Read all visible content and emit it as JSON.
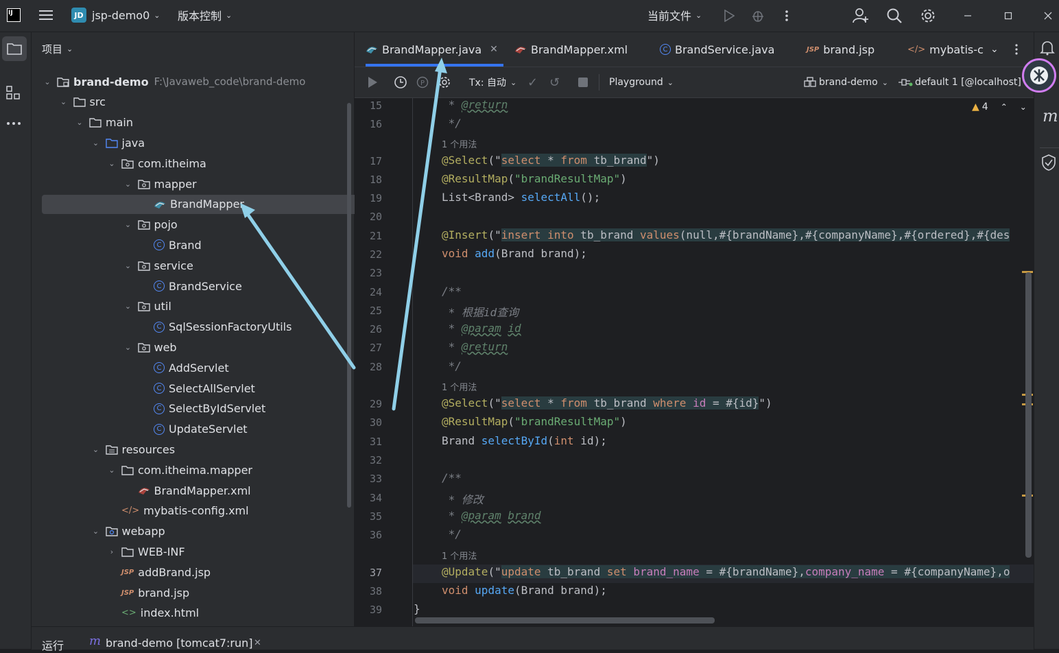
{
  "titlebar": {
    "project_badge": "JD",
    "project_name": "jsp-demo0",
    "vcs_label": "版本控制",
    "run_config": "当前文件"
  },
  "project_panel": {
    "title": "项目",
    "tree": [
      {
        "label": "brand-demo",
        "path": "F:\\Javaweb_code\\brand-demo",
        "icon": "module-folder-icon",
        "depth": 0,
        "expanded": true
      },
      {
        "label": "src",
        "icon": "folder-icon",
        "depth": 1,
        "expanded": true
      },
      {
        "label": "main",
        "icon": "folder-icon",
        "depth": 2,
        "expanded": true
      },
      {
        "label": "java",
        "icon": "source-folder-icon",
        "depth": 3,
        "expanded": true
      },
      {
        "label": "com.itheima",
        "icon": "package-icon",
        "depth": 4,
        "expanded": true
      },
      {
        "label": "mapper",
        "icon": "package-icon",
        "depth": 5,
        "expanded": true
      },
      {
        "label": "BrandMapper",
        "icon": "mybatis-icon",
        "depth": 6,
        "selected": true
      },
      {
        "label": "pojo",
        "icon": "package-icon",
        "depth": 5,
        "expanded": true
      },
      {
        "label": "Brand",
        "icon": "class-icon",
        "depth": 6
      },
      {
        "label": "service",
        "icon": "package-icon",
        "depth": 5,
        "expanded": true
      },
      {
        "label": "BrandService",
        "icon": "class-icon",
        "depth": 6
      },
      {
        "label": "util",
        "icon": "package-icon",
        "depth": 5,
        "expanded": true
      },
      {
        "label": "SqlSessionFactoryUtils",
        "icon": "class-icon",
        "depth": 6
      },
      {
        "label": "web",
        "icon": "package-icon",
        "depth": 5,
        "expanded": true
      },
      {
        "label": "AddServlet",
        "icon": "class-icon",
        "depth": 6
      },
      {
        "label": "SelectAllServlet",
        "icon": "class-icon",
        "depth": 6
      },
      {
        "label": "SelectByIdServlet",
        "icon": "class-icon",
        "depth": 6
      },
      {
        "label": "UpdateServlet",
        "icon": "class-icon",
        "depth": 6
      },
      {
        "label": "resources",
        "icon": "resources-folder-icon",
        "depth": 3,
        "expanded": true
      },
      {
        "label": "com.itheima.mapper",
        "icon": "folder-icon",
        "depth": 4,
        "expanded": true
      },
      {
        "label": "BrandMapper.xml",
        "icon": "mybatis-xml-icon",
        "depth": 5
      },
      {
        "label": "mybatis-config.xml",
        "icon": "xml-icon",
        "depth": 4
      },
      {
        "label": "webapp",
        "icon": "web-folder-icon",
        "depth": 3,
        "expanded": true
      },
      {
        "label": "WEB-INF",
        "icon": "folder-icon",
        "depth": 4,
        "expanded": false
      },
      {
        "label": "addBrand.jsp",
        "icon": "jsp-icon",
        "depth": 4
      },
      {
        "label": "brand.jsp",
        "icon": "jsp-icon",
        "depth": 4
      },
      {
        "label": "index.html",
        "icon": "html-icon",
        "depth": 4
      }
    ]
  },
  "editor": {
    "tabs": [
      {
        "label": "BrandMapper.java",
        "active": true,
        "closable": true
      },
      {
        "label": "BrandMapper.xml"
      },
      {
        "label": "BrandService.java"
      },
      {
        "label": "brand.jsp"
      },
      {
        "label": "mybatis-c"
      }
    ],
    "db_toolbar": {
      "tx_label": "Tx: 自动",
      "playground_label": "Playground",
      "datasource": "brand-demo",
      "session": "default 1 [@localhost]"
    },
    "inspection_count": "4",
    "usage_hint": "1 个用法",
    "line_numbers": [
      "15",
      "16",
      "17",
      "18",
      "19",
      "20",
      "21",
      "22",
      "23",
      "24",
      "25",
      "26",
      "27",
      "28",
      "29",
      "30",
      "31",
      "32",
      "33",
      "34",
      "35",
      "36",
      "37",
      "38",
      "39"
    ],
    "code": {
      "l15_star": " * ",
      "l15_tag": "@return",
      "l16": " */",
      "l17_ann": "@Select",
      "l17_open": "(\"",
      "l17_kw1": "select",
      "l17_mid": " * ",
      "l17_kw2": "from",
      "l17_rest": " tb_brand",
      "l17_close": "\")",
      "l18_ann": "@ResultMap",
      "l18_rest": "(",
      "l18_str": "\"brandResultMap\"",
      "l18_close": ")",
      "l19_a": "List<Brand> ",
      "l19_fn": "selectAll",
      "l19_b": "();",
      "l21_ann": "@Insert",
      "l21_open": "(\"",
      "l21_kw1": "insert into",
      "l21_t": " tb_brand ",
      "l21_kw2": "values",
      "l21_rest": "(null,#{brandName},#{companyName},#{ordered},#{des",
      "l22_kw": "void ",
      "l22_fn": "add",
      "l22_rest": "(Brand brand);",
      "l24": "/**",
      "l25": " * 根据id查询",
      "l26_star": " * ",
      "l26_tag": "@param",
      "l26_sp": " ",
      "l26_id": "id",
      "l27_star": " * ",
      "l27_tag": "@return",
      "l28": " */",
      "l29_ann": "@Select",
      "l29_open": "(\"",
      "l29_kw1": "select",
      "l29_mid": " * ",
      "l29_kw2": "from",
      "l29_t": " tb_brand ",
      "l29_kw3": "where",
      "l29_id": " id",
      "l29_rest": " = #{id}",
      "l29_close": "\")",
      "l30_ann": "@ResultMap",
      "l30_rest": "(",
      "l30_str": "\"brandResultMap\"",
      "l30_close": ")",
      "l31_a": "Brand ",
      "l31_fn": "selectById",
      "l31_b": "(",
      "l31_kw": "int",
      "l31_c": " id);",
      "l33": "/**",
      "l34": " * 修改",
      "l35_star": " * ",
      "l35_tag": "@param",
      "l35_sp": " ",
      "l35_id": "brand",
      "l36": " */",
      "l37_ann": "@Update",
      "l37_open": "(\"",
      "l37_kw1": "update",
      "l37_t": " tb_brand ",
      "l37_kw2": "set",
      "l37_c1": " brand_name",
      "l37_m1": " = #{brandName},",
      "l37_c2": "company_name",
      "l37_m2": " = #{companyName},o",
      "l38_kw": "void ",
      "l38_fn": "update",
      "l38_rest": "(Brand brand);",
      "l39": "}"
    }
  },
  "bottom": {
    "run_label": "运行",
    "run_config": "brand-demo [tomcat7:run]"
  },
  "colors": {
    "accent": "#3574f0",
    "annotation_arrow": "#8fcfe8"
  }
}
